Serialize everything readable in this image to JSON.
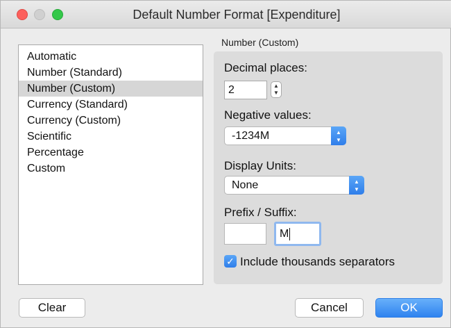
{
  "window": {
    "title": "Default Number Format [Expenditure]"
  },
  "format_list": {
    "items": [
      "Automatic",
      "Number (Standard)",
      "Number (Custom)",
      "Currency (Standard)",
      "Currency (Custom)",
      "Scientific",
      "Percentage",
      "Custom"
    ],
    "selected": "Number (Custom)"
  },
  "settings": {
    "caption": "Number (Custom)",
    "decimal_places": {
      "label": "Decimal places:",
      "value": "2"
    },
    "negative_values": {
      "label": "Negative values:",
      "value": "-1234M"
    },
    "display_units": {
      "label": "Display Units:",
      "value": "None"
    },
    "prefix_suffix": {
      "label": "Prefix / Suffix:",
      "prefix": "",
      "suffix": "M"
    },
    "thousands_separators": {
      "label": "Include thousands separators",
      "checked": true
    }
  },
  "buttons": {
    "clear": "Clear",
    "cancel": "Cancel",
    "ok": "OK"
  },
  "colors": {
    "accent": "#2f83ef",
    "selection": "#d6d6d6",
    "close": "#fc605c",
    "zoom": "#34c84a"
  },
  "icons": {
    "stepper": "up-down-stepper-icon",
    "popup": "chevron-up-down-icon",
    "check": "checkmark-icon"
  }
}
